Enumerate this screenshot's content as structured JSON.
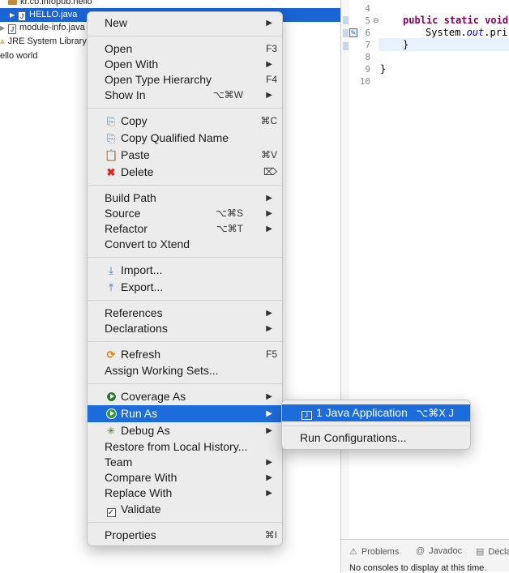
{
  "explorer": {
    "rows": [
      {
        "label": "kr.co.infopub.hello"
      },
      {
        "label": "HELLO.java"
      },
      {
        "label": "module-info.java"
      },
      {
        "label": "JRE System Library"
      },
      {
        "label": "ello world"
      }
    ]
  },
  "editor": {
    "line_numbers": [
      "4",
      "5",
      "6",
      "7",
      "8",
      "9",
      "10"
    ],
    "lines": {
      "l5_kw": "public static void",
      "l6_pre": "System.",
      "l6_fld": "out",
      "l6_post": ".pri",
      "l7": "}",
      "l9": "}"
    }
  },
  "bottom": {
    "tabs": [
      {
        "label": "Problems",
        "icon": "problems-icon"
      },
      {
        "label": "Javadoc",
        "icon": "at-sign-icon"
      },
      {
        "label": "Decla",
        "icon": "declaration-icon"
      }
    ],
    "console_message": "No consoles to display at this time."
  },
  "context_menu": {
    "new": "New",
    "open": "Open",
    "open_sc": "F3",
    "open_with": "Open With",
    "open_type_hierarchy": "Open Type Hierarchy",
    "open_type_hierarchy_sc": "F4",
    "show_in": "Show In",
    "show_in_sc": "⌥⌘W",
    "copy": "Copy",
    "copy_sc": "⌘C",
    "copy_qualified": "Copy Qualified Name",
    "paste": "Paste",
    "paste_sc": "⌘V",
    "delete": "Delete",
    "delete_sc": "⌦",
    "build_path": "Build Path",
    "source": "Source",
    "source_sc": "⌥⌘S",
    "refactor": "Refactor",
    "refactor_sc": "⌥⌘T",
    "convert_xtend": "Convert to Xtend",
    "import": "Import...",
    "export": "Export...",
    "references": "References",
    "declarations": "Declarations",
    "refresh": "Refresh",
    "refresh_sc": "F5",
    "assign_working_sets": "Assign Working Sets...",
    "coverage_as": "Coverage As",
    "run_as": "Run As",
    "debug_as": "Debug As",
    "restore_history": "Restore from Local History...",
    "team": "Team",
    "compare_with": "Compare With",
    "replace_with": "Replace With",
    "validate": "Validate",
    "properties": "Properties",
    "properties_sc": "⌘I"
  },
  "run_as_submenu": {
    "java_application": "1 Java Application",
    "java_application_sc": "⌥⌘X J",
    "run_configurations": "Run Configurations..."
  },
  "colors": {
    "selection": "#1d6cdb",
    "keyword": "#7f0055",
    "run_icon": "#2f9a3c"
  }
}
